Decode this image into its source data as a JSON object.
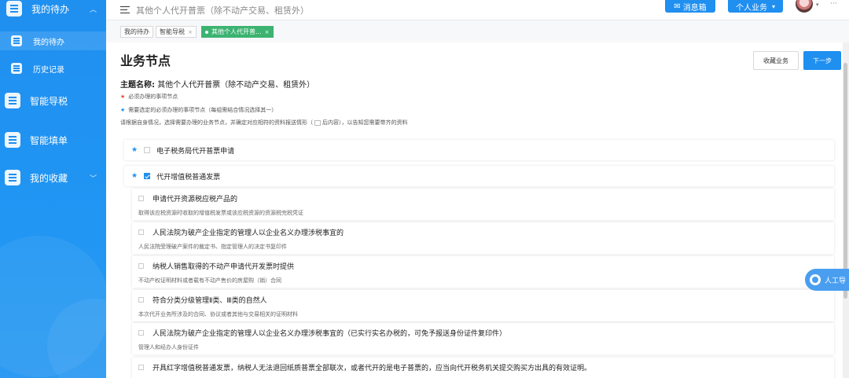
{
  "sidebar": {
    "items": [
      {
        "label": "我的待办"
      },
      {
        "label": "我的待办"
      },
      {
        "label": "历史记录"
      },
      {
        "label": "智能导税"
      },
      {
        "label": "智能填单"
      },
      {
        "label": "我的收藏"
      }
    ]
  },
  "topbar": {
    "breadcrumb": "其他个人代开普票（除不动产交易、租赁外）",
    "message_button": "消息箱",
    "personal_button": "个人业务"
  },
  "tabs": [
    {
      "label": "我的待办"
    },
    {
      "label": "智能导税"
    },
    {
      "label": "其他个人代开普..."
    }
  ],
  "content": {
    "title": "业务节点",
    "collect_button": "收藏业务",
    "next_button": "下一步",
    "subject_label": "主题名称:",
    "subject_value": "其他个人代开普票（除不动产交易、租赁外）",
    "note_required": "必须办理的事项节点",
    "note_select": "需要选定的必须办理的事项节点（每组需结合情况选择其一）",
    "note_hint_a": "请根据自身情况，选择需要办理的业务节点，并确定对应相符的资料报送情形（",
    "note_hint_b": "后内容），以告知您需要带齐的资料",
    "groups": [
      {
        "label": "电子税务局代开普票申请",
        "checked": false
      },
      {
        "label": "代开增值税普通发票",
        "checked": true
      }
    ],
    "items": [
      {
        "title": "申请代开资源税应税产品的",
        "desc": "取得该应税资源时收取的增值税发票或该应税资源的资源税完税凭证"
      },
      {
        "title": "人民法院为破产企业指定的管理人以企业名义办理涉税事宜的",
        "desc": "人民法院受理破产案件的裁定书、指定管理人的决定书复印件"
      },
      {
        "title": "纳税人销售取得的不动产申请代开发票时提供",
        "desc": "不动产权证明材料或者载有不动产售价的房屋购（销）合同"
      },
      {
        "title": "符合分类分级管理Ⅱ类、Ⅲ类的自然人",
        "desc": "本次代开业务所涉及的合同、协议或者其他与交易相关的证明材料"
      },
      {
        "title": "人民法院为破产企业指定的管理人以企业名义办理涉税事宜的（已实行实名办税的，可免予报送身份证件复印件）",
        "desc": "管理人和经办人身份证件"
      },
      {
        "title": "开具红字增值税普通发票，纳税人无法退回纸质普票全部联次，或者代开的是电子普票的，应当向代开税务机关提交购买方出具的有效证明。",
        "desc": ""
      }
    ]
  },
  "service": {
    "label": "人工导"
  },
  "colors": {
    "primary": "#1f8ff0",
    "tab_active": "#3cb371",
    "star_red": "#e74c3c"
  }
}
